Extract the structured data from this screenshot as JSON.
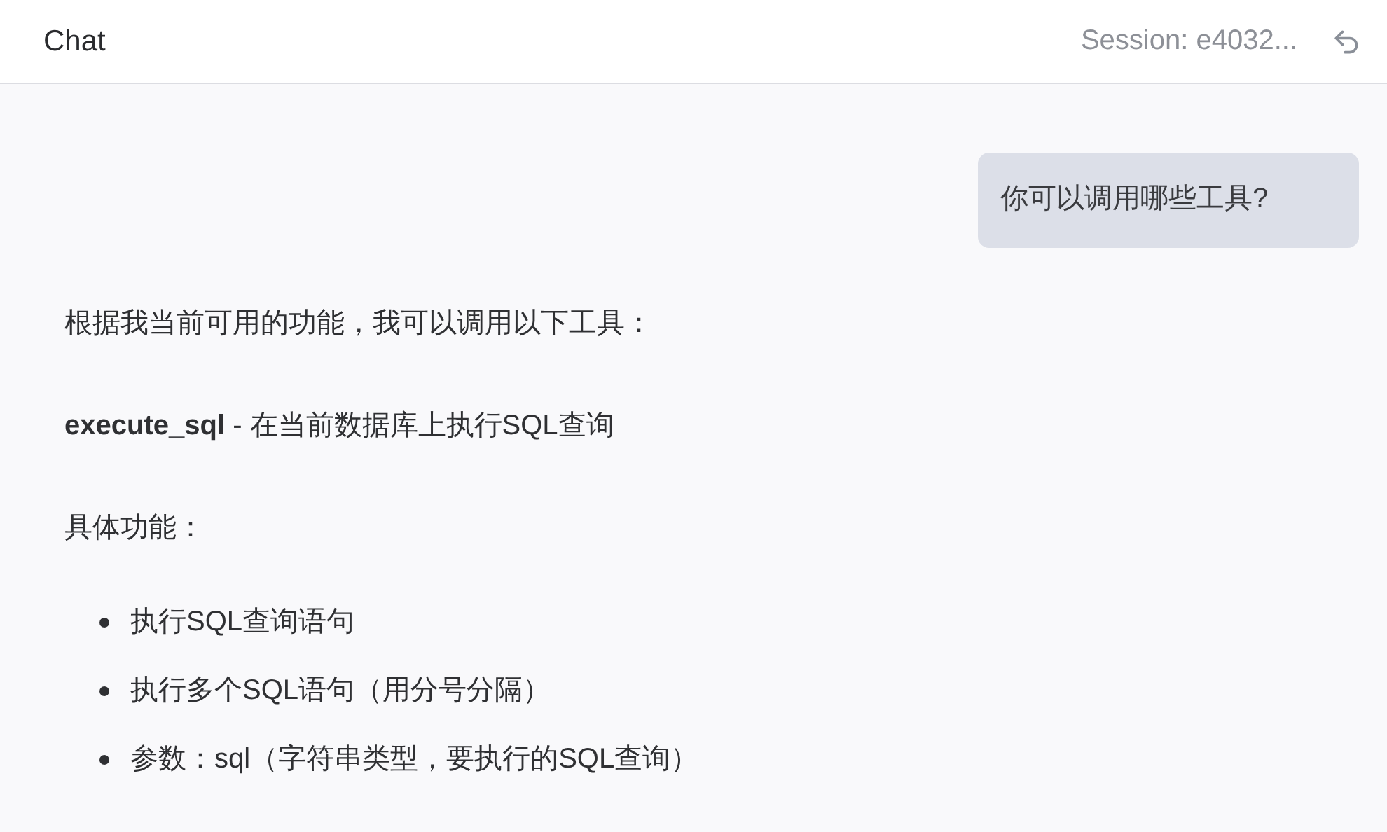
{
  "header": {
    "title": "Chat",
    "session": "Session: e4032..."
  },
  "messages": [
    {
      "kind": "user",
      "blocks": [
        {
          "kind": "paragraph",
          "text": "你可以调用哪些工具?"
        }
      ]
    },
    {
      "kind": "assistant",
      "blocks": [
        {
          "kind": "paragraph",
          "text": "根据我当前可用的功能，我可以调用以下工具："
        },
        {
          "kind": "paragraph",
          "text": "**execute_sql** - 在当前数据库上执行SQL查询"
        },
        {
          "kind": "paragraph",
          "text": "具体功能："
        },
        {
          "kind": "list",
          "items": [
            "执行SQL查询语句",
            "执行多个SQL语句（用分号分隔）",
            "参数：sql（字符串类型，要执行的SQL查询）"
          ]
        }
      ]
    }
  ]
}
